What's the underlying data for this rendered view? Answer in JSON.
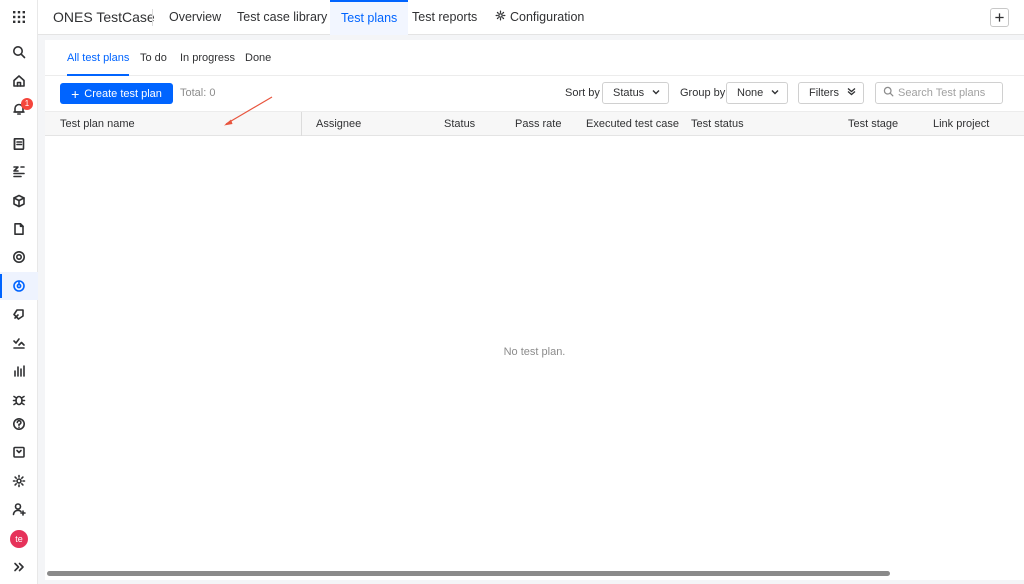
{
  "app": {
    "title": "ONES TestCase",
    "notification_count": "1",
    "avatar_initials": "te"
  },
  "nav": {
    "tabs": [
      {
        "label": "Overview"
      },
      {
        "label": "Test case library"
      },
      {
        "label": "Test plans"
      },
      {
        "label": "Test reports"
      },
      {
        "label": "Configuration"
      }
    ],
    "active_tab": "Test plans"
  },
  "subtabs": [
    {
      "label": "All test plans"
    },
    {
      "label": "To do"
    },
    {
      "label": "In progress"
    },
    {
      "label": "Done"
    }
  ],
  "toolbar": {
    "create_label": "Create test plan",
    "total_label": "Total: 0",
    "sort_label": "Sort by",
    "sort_value": "Status",
    "group_label": "Group by",
    "group_value": "None",
    "filters_label": "Filters",
    "search_placeholder": "Search Test plans"
  },
  "table": {
    "columns": [
      "Test plan name",
      "Assignee",
      "Status",
      "Pass rate",
      "Executed test case",
      "Test status",
      "Test stage",
      "Link project"
    ],
    "rows": [],
    "empty_text": "No test plan."
  },
  "colors": {
    "accent": "#0064ff",
    "badge": "#f5453b",
    "avatar": "#e6325a",
    "annotation_arrow": "#e8553e"
  },
  "rail_icons": [
    "apps-grid-icon",
    "search-icon",
    "home-icon",
    "bell-icon",
    "notebook-icon",
    "sort-alpha-icon",
    "cube-icon",
    "document-icon",
    "target-icon",
    "testcase-icon",
    "rocket-icon",
    "checklist-chart-icon",
    "bar-chart-icon",
    "bug-icon",
    "help-icon",
    "calendar-icon",
    "settings-icon",
    "user-add-icon",
    "avatar",
    "expand-icon"
  ]
}
